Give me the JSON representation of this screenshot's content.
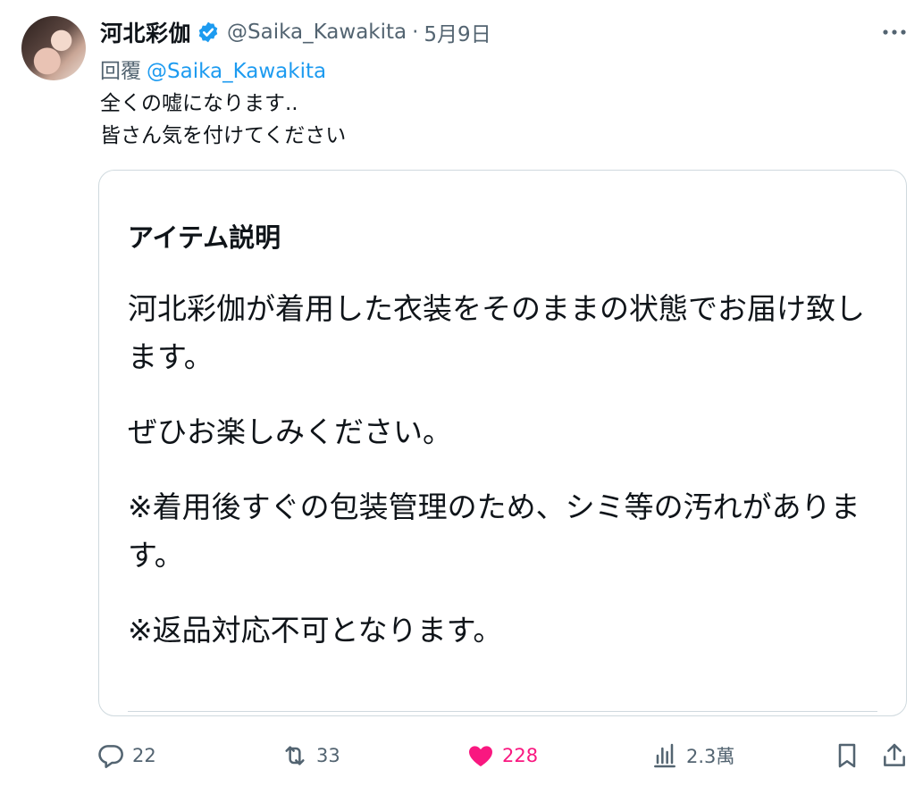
{
  "tweet": {
    "author_name": "河北彩伽",
    "handle": "@Saika_Kawakita",
    "separator": "·",
    "date": "5月9日",
    "reply_prefix": "回覆",
    "reply_to": "@Saika_Kawakita",
    "text_lines": [
      "全くの嘘になります..",
      "皆さん気を付けてください"
    ]
  },
  "card": {
    "title": "アイテム説明",
    "paragraphs": [
      "河北彩伽が着用した衣装をそのままの状態でお届け致します。",
      "ぜひお楽しみください。",
      "※着用後すぐの包装管理のため、シミ等の汚れがあります。",
      "※返品対応不可となります。"
    ]
  },
  "actions": {
    "replies": "22",
    "reposts": "33",
    "likes": "228",
    "views": "2.3萬"
  },
  "icons": {
    "verified": "verified-badge-icon",
    "more": "more-icon",
    "reply": "reply-icon",
    "repost": "repost-icon",
    "like": "heart-icon",
    "views": "views-icon",
    "bookmark": "bookmark-icon",
    "share": "share-icon"
  },
  "colors": {
    "accent": "#1d9bf0",
    "like": "#f91880",
    "secondary_text": "#536471"
  }
}
